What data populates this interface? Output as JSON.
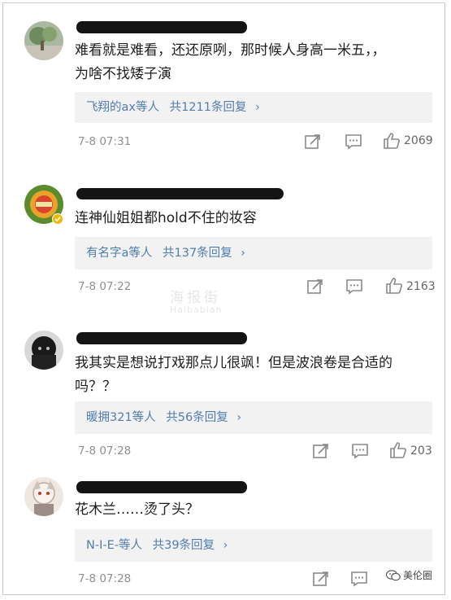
{
  "comments": [
    {
      "text_line1": "难看就是难看，还还原咧，那时候人身高一米五，，",
      "text_line2": "为啥不找矮子演",
      "reply_users": "飞翔的ax等人",
      "reply_count": "共1211条回复",
      "time": "7-8 07:31",
      "likes": "2069"
    },
    {
      "text_line1": "连神仙姐姐都hold不住的妆容",
      "reply_users": "有名字a等人",
      "reply_count": "共137条回复",
      "time": "7-8 07:22",
      "likes": "2163"
    },
    {
      "text_line1": "我其实是想说打戏那点儿很飒！但是波浪卷是合适的",
      "text_line2": "吗？？",
      "reply_users": "暖拥321等人",
      "reply_count": "共56条回复",
      "time": "7-8 07:28",
      "likes": "203"
    },
    {
      "text_line1": "花木兰……烫了头？",
      "reply_users": "N-I-E-等人",
      "reply_count": "共39条回复",
      "time": "7-8 07:28",
      "likes": ""
    }
  ],
  "icons": {
    "repost": "repost-icon",
    "comment": "comment-icon",
    "like": "thumbs-up-icon"
  },
  "watermark": {
    "main": "海报街",
    "sub": "Haibabian"
  },
  "brand": {
    "label": "美伦圈"
  },
  "colors": {
    "link": "#507daf",
    "reply_bg": "#f2f2f2",
    "meta": "#8f8f8f"
  }
}
